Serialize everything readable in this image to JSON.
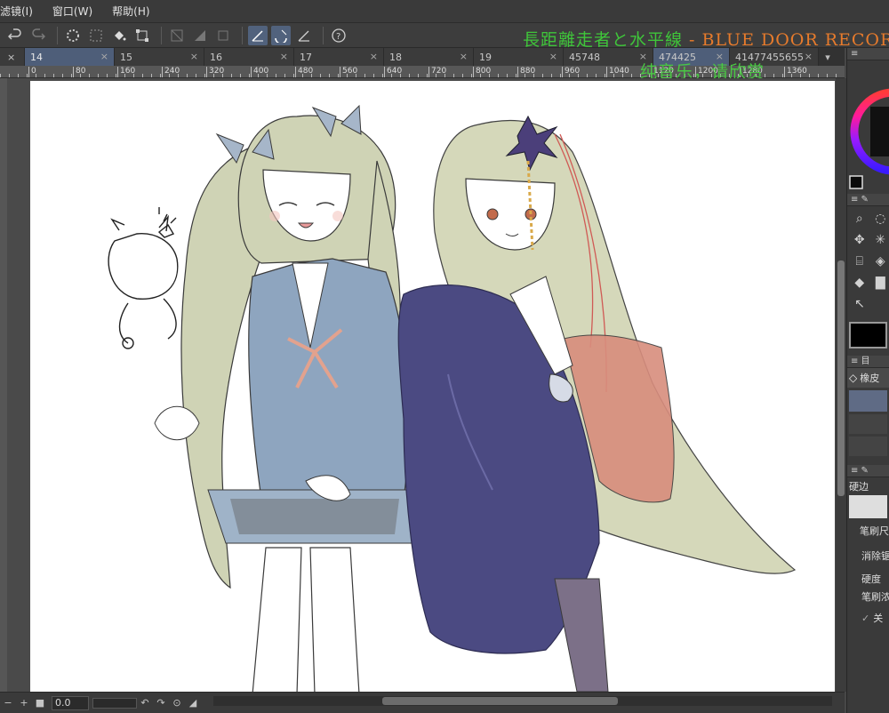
{
  "menubar": {
    "items": [
      "滤镜(I)",
      "窗口(W)",
      "帮助(H)"
    ]
  },
  "overlay": {
    "title_jp": "長距離走者と水平線",
    "title_en": " - BLUE DOOR RECORD",
    "subtitle": "纯音乐，请欣赏"
  },
  "tabs": [
    {
      "label": "14",
      "close": "×",
      "active": true
    },
    {
      "label": "15",
      "close": "×",
      "active": false
    },
    {
      "label": "16",
      "close": "×",
      "active": false
    },
    {
      "label": "17",
      "close": "×",
      "active": false
    },
    {
      "label": "18",
      "close": "×",
      "active": false
    },
    {
      "label": "19",
      "close": "×",
      "active": false
    },
    {
      "label": "45748",
      "close": "×",
      "active": false
    },
    {
      "label": "474425",
      "close": "×",
      "active": false
    },
    {
      "label": "41477455655",
      "close": "×",
      "active": false
    }
  ],
  "tab_arrow": "▾",
  "ruler": {
    "labels": [
      "0",
      "80",
      "160",
      "240",
      "320",
      "400",
      "480",
      "560",
      "640",
      "720",
      "800",
      "880",
      "960",
      "1040",
      "1120",
      "1200",
      "1280",
      "1360"
    ]
  },
  "bottombar": {
    "zoom_value": "0.0"
  },
  "right_panel": {
    "eraser_label": "橡皮",
    "hard_edge_label": "硬边",
    "brush_size_label": "笔刷尺",
    "antialias_label": "消除锯",
    "hardness_label": "硬度",
    "brush_density_label": "笔刷浓",
    "off_label": "关"
  },
  "colors": {
    "accent_tab": "#4e5e79",
    "title_green": "#3fc63a",
    "title_orange": "#e77b2c"
  }
}
